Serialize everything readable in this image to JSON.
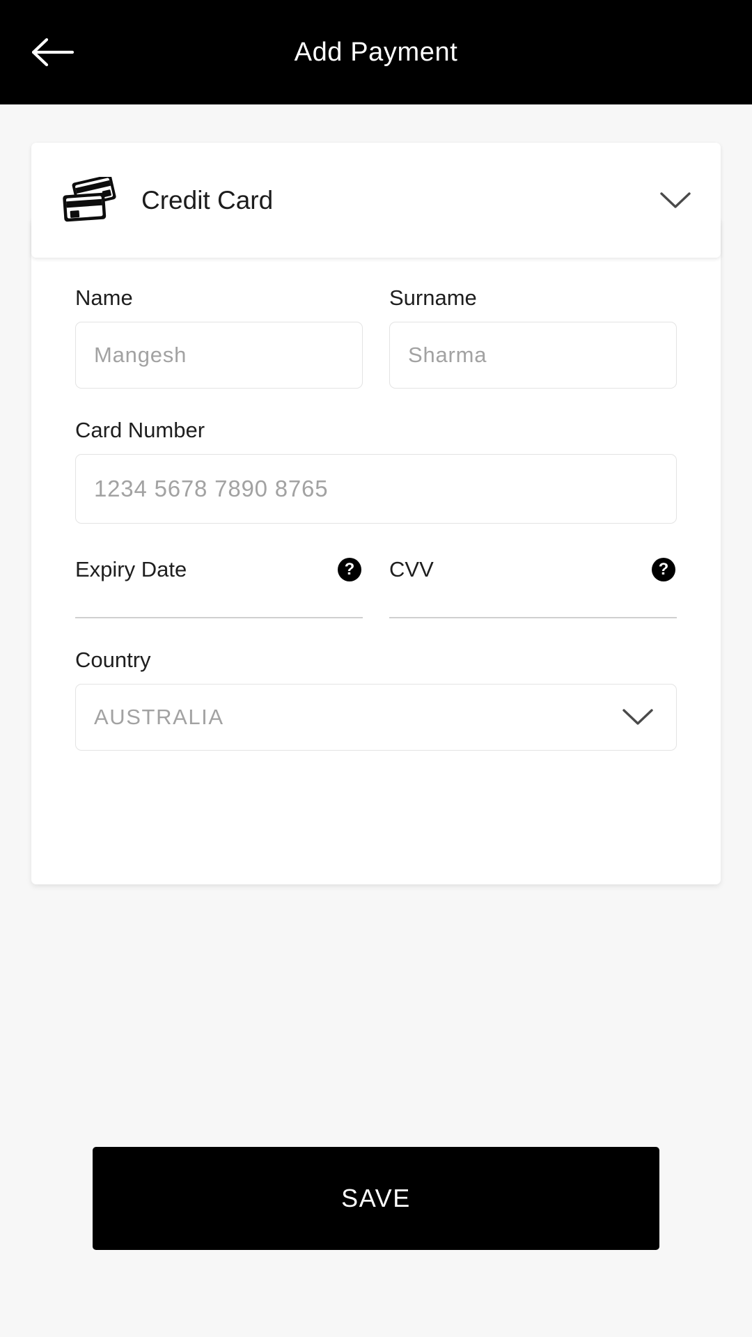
{
  "appbar": {
    "title": "Add Payment",
    "back_icon": "arrow-left-icon"
  },
  "payment_method": {
    "icon": "credit-card-icon",
    "label": "Credit Card",
    "expand_icon": "chevron-down-icon"
  },
  "form": {
    "name": {
      "label": "Name",
      "placeholder": "Mangesh",
      "value": ""
    },
    "surname": {
      "label": "Surname",
      "placeholder": "Sharma",
      "value": ""
    },
    "card_number": {
      "label": "Card Number",
      "placeholder": "1234 5678 7890 8765",
      "value": ""
    },
    "expiry": {
      "label": "Expiry Date",
      "placeholder": "",
      "value": "",
      "help_icon": "help-circle-icon",
      "help_glyph": "?"
    },
    "cvv": {
      "label": "CVV",
      "placeholder": "",
      "value": "",
      "help_icon": "help-circle-icon",
      "help_glyph": "?"
    },
    "country": {
      "label": "Country",
      "value": "AUSTRALIA",
      "dropdown_icon": "chevron-down-icon"
    }
  },
  "actions": {
    "save_label": "SAVE"
  },
  "colors": {
    "appbar_bg": "#000000",
    "page_bg": "#f7f7f7",
    "card_bg": "#ffffff",
    "primary_button": "#000000",
    "button_text": "#ffffff",
    "placeholder_text": "#a2a2a2",
    "label_text": "#1e1e1e",
    "border": "#e3e3e3",
    "underline": "#cfcfcf"
  }
}
